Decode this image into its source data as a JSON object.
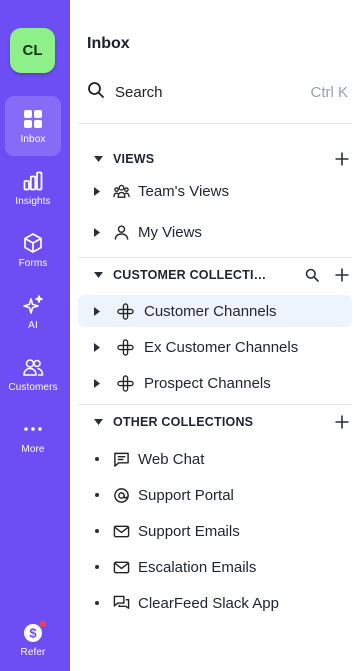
{
  "rail": {
    "avatar_initials": "CL",
    "items": [
      {
        "label": "Inbox",
        "icon": "grid-icon",
        "active": true
      },
      {
        "label": "Insights",
        "icon": "bar-chart-icon"
      },
      {
        "label": "Forms",
        "icon": "cube-icon"
      },
      {
        "label": "AI",
        "icon": "sparkle-icon"
      },
      {
        "label": "Customers",
        "icon": "people-icon"
      },
      {
        "label": "More",
        "icon": "dots-icon"
      }
    ],
    "refer": {
      "label": "Refer",
      "icon": "dollar-badge-icon"
    }
  },
  "panel": {
    "title": "Inbox",
    "search": {
      "placeholder": "Search",
      "shortcut": "Ctrl K"
    },
    "sections": {
      "views": {
        "title": "VIEWS",
        "items": [
          {
            "label": "Team's Views",
            "icon": "team-icon"
          },
          {
            "label": "My Views",
            "icon": "person-icon"
          }
        ]
      },
      "customer": {
        "title": "CUSTOMER COLLECTIONS",
        "items": [
          {
            "label": "Customer Channels",
            "icon": "slack-icon",
            "selected": true
          },
          {
            "label": "Ex Customer Channels",
            "icon": "slack-icon"
          },
          {
            "label": "Prospect Channels",
            "icon": "slack-icon"
          }
        ]
      },
      "other": {
        "title": "OTHER COLLECTIONS",
        "items": [
          {
            "label": "Web Chat",
            "icon": "chat-icon"
          },
          {
            "label": "Support Portal",
            "icon": "at-icon"
          },
          {
            "label": "Support Emails",
            "icon": "mail-icon"
          },
          {
            "label": "Escalation Emails",
            "icon": "mail-icon"
          },
          {
            "label": "ClearFeed Slack App",
            "icon": "chat-stack-icon"
          }
        ]
      }
    }
  },
  "colors": {
    "rail_bg": "#6d4ef5",
    "avatar_bg": "#8ef089",
    "selected_row_bg": "#eef4fd",
    "badge_dot": "#ff3b4a"
  }
}
